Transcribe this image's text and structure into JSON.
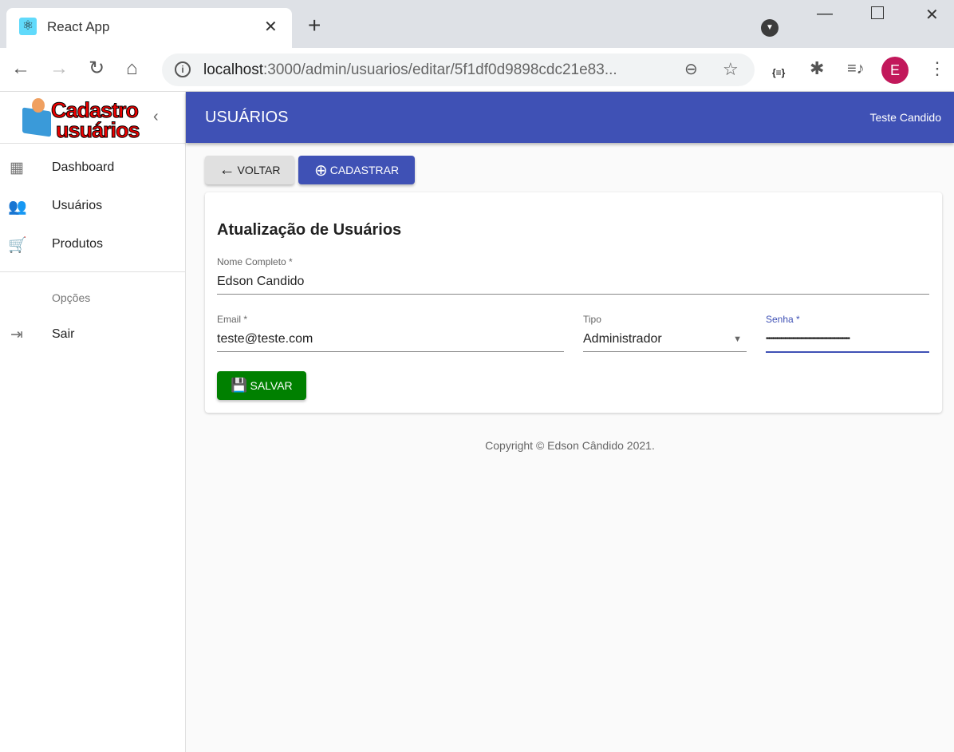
{
  "browser": {
    "tab_title": "React App",
    "url_host": "localhost",
    "url_rest": ":3000/admin/usuarios/editar/5f1df0d9898cdc21e83...",
    "avatar_letter": "E"
  },
  "sidebar": {
    "logo_line1": "Cadastro",
    "logo_line2": "usuários",
    "items": [
      {
        "label": "Dashboard"
      },
      {
        "label": "Usuários"
      },
      {
        "label": "Produtos"
      }
    ],
    "section": "Opções",
    "logout": "Sair"
  },
  "header": {
    "title": "USUÁRIOS",
    "user": "Teste Candido"
  },
  "actions": {
    "back": "VOLTAR",
    "create": "CADASTRAR"
  },
  "form": {
    "title": "Atualização de Usuários",
    "name_label": "Nome Completo *",
    "name_value": "Edson Candido",
    "email_label": "Email *",
    "email_value": "teste@teste.com",
    "type_label": "Tipo",
    "type_value": "Administrador",
    "password_label": "Senha *",
    "password_value": "••••••••••••••••••••••••••••••••••••••••••",
    "save": "SALVAR"
  },
  "footer": {
    "copyright": "Copyright © Edson Cândido 2021."
  },
  "colors": {
    "primary": "#3f51b5",
    "save": "#008000"
  }
}
